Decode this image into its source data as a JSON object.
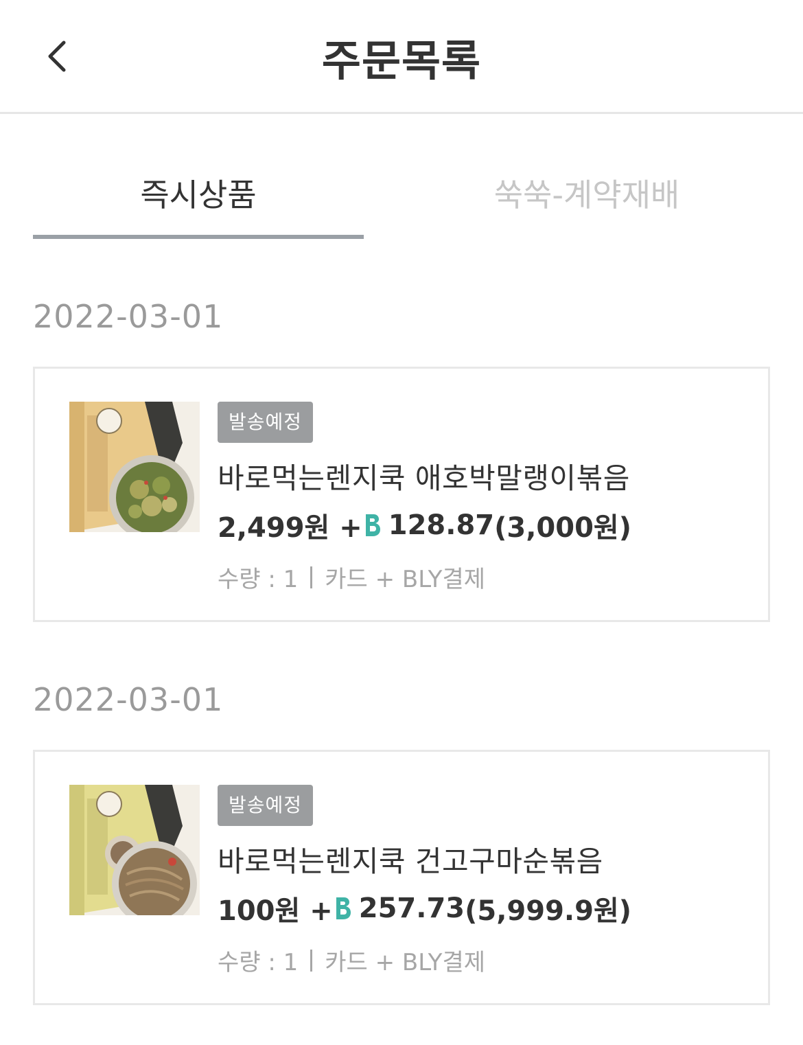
{
  "header": {
    "title": "주문목록",
    "back_icon": "chevron-left-icon"
  },
  "tabs": [
    {
      "label": "즉시상품",
      "active": true
    },
    {
      "label": "쑥쑥-계약재배",
      "active": false
    }
  ],
  "colors": {
    "text_primary": "#333333",
    "text_secondary": "#a6a6a6",
    "badge_bg": "#9b9d9f",
    "coin_teal": "#3fb3a6",
    "tab_underline": "#9aa0a6"
  },
  "orders": [
    {
      "date": "2022-03-01",
      "status": "발송예정",
      "product_name": "바로먹는렌지쿡 애호박말랭이볶음",
      "price": "2,499원 +",
      "coin_icon": "b-coin-icon",
      "coin_amount": "128.87",
      "coin_krw": "(3,000원)",
      "quantity_label": "수량 : 1",
      "payment_method": "카드 + BLY결제",
      "thumbnail": "zucchini-dish-package-image"
    },
    {
      "date": "2022-03-01",
      "status": "발송예정",
      "product_name": "바로먹는렌지쿡 건고구마순볶음",
      "price": "100원 +",
      "coin_icon": "b-coin-icon",
      "coin_amount": "257.73",
      "coin_krw": "(5,999.9원)",
      "quantity_label": "수량 : 1",
      "payment_method": "카드 + BLY결제",
      "thumbnail": "sweet-potato-stem-dish-package-image"
    }
  ]
}
